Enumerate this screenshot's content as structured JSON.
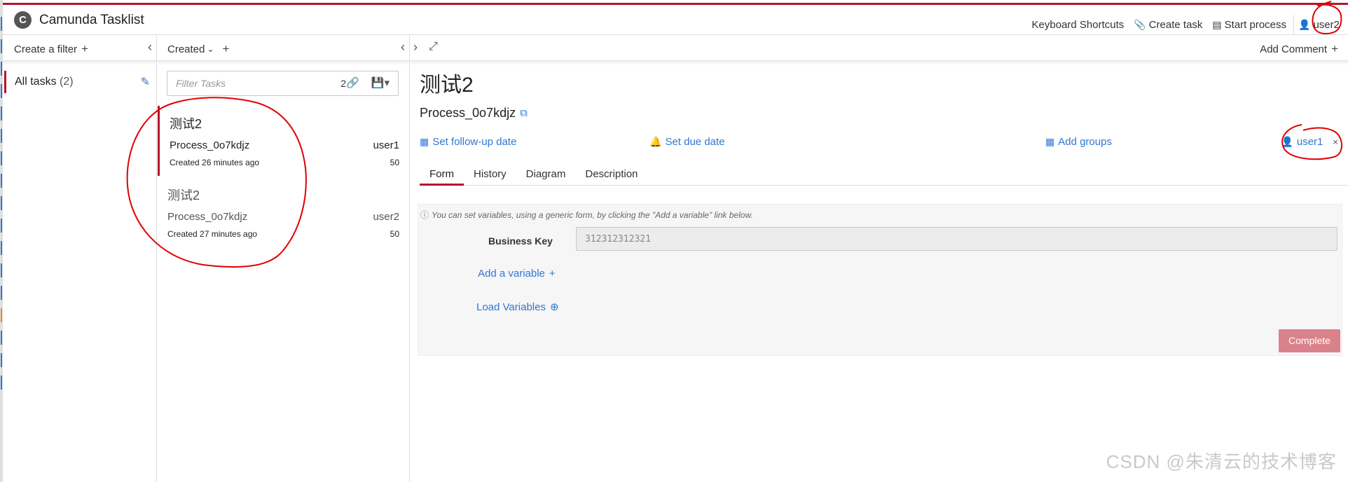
{
  "header": {
    "logo_glyph": "C",
    "brand": "Camunda Tasklist",
    "keyboard_shortcuts": "Keyboard Shortcuts",
    "create_task": "Create task",
    "start_process": "Start process",
    "user": "user2"
  },
  "filters": {
    "create_filter": "Create a filter",
    "items": [
      {
        "label": "All tasks",
        "count": "(2)"
      }
    ]
  },
  "task_list": {
    "sort_label": "Created",
    "filter_placeholder": "Filter Tasks",
    "filter_count": "2",
    "tasks": [
      {
        "name": "测试2",
        "process": "Process_0o7kdjz",
        "assignee": "user1",
        "created": "Created 26 minutes ago",
        "priority": "50"
      },
      {
        "name": "测试2",
        "process": "Process_0o7kdjz",
        "assignee": "user2",
        "created": "Created 27 minutes ago",
        "priority": "50"
      }
    ]
  },
  "detail": {
    "add_comment": "Add Comment",
    "title": "测试2",
    "process": "Process_0o7kdjz",
    "set_followup": "Set follow-up date",
    "set_due": "Set due date",
    "add_groups": "Add groups",
    "assignee": "user1",
    "tabs": [
      "Form",
      "History",
      "Diagram",
      "Description"
    ],
    "active_tab": "Form",
    "form": {
      "hint": "You can set variables, using a generic form, by clicking the \"Add a variable\" link below.",
      "business_key_label": "Business Key",
      "business_key_value": "312312312321",
      "add_variable": "Add a variable",
      "load_variables": "Load Variables",
      "complete": "Complete"
    }
  },
  "watermark": "CSDN @朱清云的技术博客",
  "colors": {
    "accent_red": "#b5152b",
    "link_blue": "#2f77d1",
    "complete_button": "#d9828b",
    "annotation_red": "#e00000"
  }
}
